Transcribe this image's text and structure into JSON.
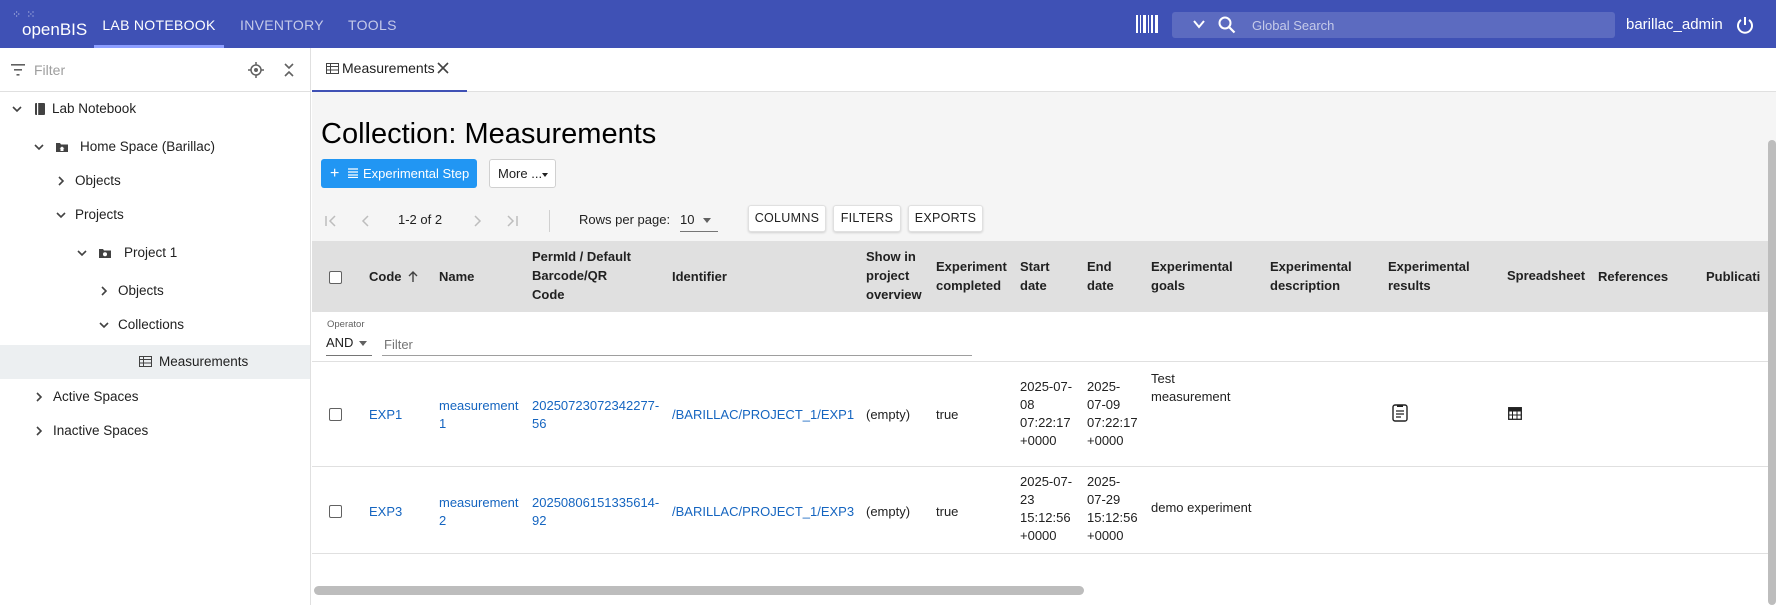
{
  "app": {
    "logo_text": "openBIS",
    "nav": [
      "LAB NOTEBOOK",
      "INVENTORY",
      "TOOLS"
    ],
    "search_placeholder": "Global Search",
    "user": "barillac_admin"
  },
  "sidebar": {
    "filter_placeholder": "Filter",
    "items": [
      {
        "label": "Lab Notebook"
      },
      {
        "label": "Home Space (Barillac)"
      },
      {
        "label": "Objects"
      },
      {
        "label": "Projects"
      },
      {
        "label": "Project 1"
      },
      {
        "label": "Objects"
      },
      {
        "label": "Collections"
      },
      {
        "label": "Measurements"
      },
      {
        "label": "Active Spaces"
      },
      {
        "label": "Inactive Spaces"
      }
    ]
  },
  "tab": {
    "label": "Measurements"
  },
  "page": {
    "title": "Collection: Measurements",
    "primary_button": "Experimental Step",
    "more_button": "More ..."
  },
  "pager": {
    "range": "1-2 of 2",
    "rows_per_page_label": "Rows per page:",
    "rows_per_page": "10",
    "buttons": [
      "COLUMNS",
      "FILTERS",
      "EXPORTS"
    ]
  },
  "table": {
    "headers": {
      "code": "Code",
      "name": "Name",
      "permid": [
        "PermId / Default",
        "Barcode/QR",
        "Code"
      ],
      "identifier": "Identifier",
      "show": [
        "Show in",
        "project",
        "overview"
      ],
      "completed": [
        "Experiment",
        "completed"
      ],
      "start": [
        "Start",
        "date"
      ],
      "end": [
        "End",
        "date"
      ],
      "goals": [
        "Experimental",
        "goals"
      ],
      "description": [
        "Experimental",
        "description"
      ],
      "results": [
        "Experimental",
        "results"
      ],
      "spreadsheet": "Spreadsheet",
      "references": "References",
      "publications": "Publicati"
    },
    "operator_label": "Operator",
    "operator_value": "AND",
    "filter_placeholder": "Filter",
    "rows": [
      {
        "code": "EXP1",
        "name": [
          "measurement",
          "1"
        ],
        "permid": [
          "20250723072342277-",
          "56"
        ],
        "identifier": "/BARILLAC/PROJECT_1/EXP1",
        "show": "(empty)",
        "completed": "true",
        "start": [
          "2025-07-",
          "08",
          "07:22:17",
          "+0000"
        ],
        "end": [
          "2025-",
          "07-09",
          "07:22:17",
          "+0000"
        ],
        "goals": [
          "Test",
          "measurement"
        ]
      },
      {
        "code": "EXP3",
        "name": [
          "measurement",
          "2"
        ],
        "permid": [
          "20250806151335614-",
          "92"
        ],
        "identifier": "/BARILLAC/PROJECT_1/EXP3",
        "show": "(empty)",
        "completed": "true",
        "start": [
          "2025-07-",
          "23",
          "15:12:56",
          "+0000"
        ],
        "end": [
          "2025-",
          "07-29",
          "15:12:56",
          "+0000"
        ],
        "goals": [
          "demo experiment"
        ]
      }
    ]
  }
}
